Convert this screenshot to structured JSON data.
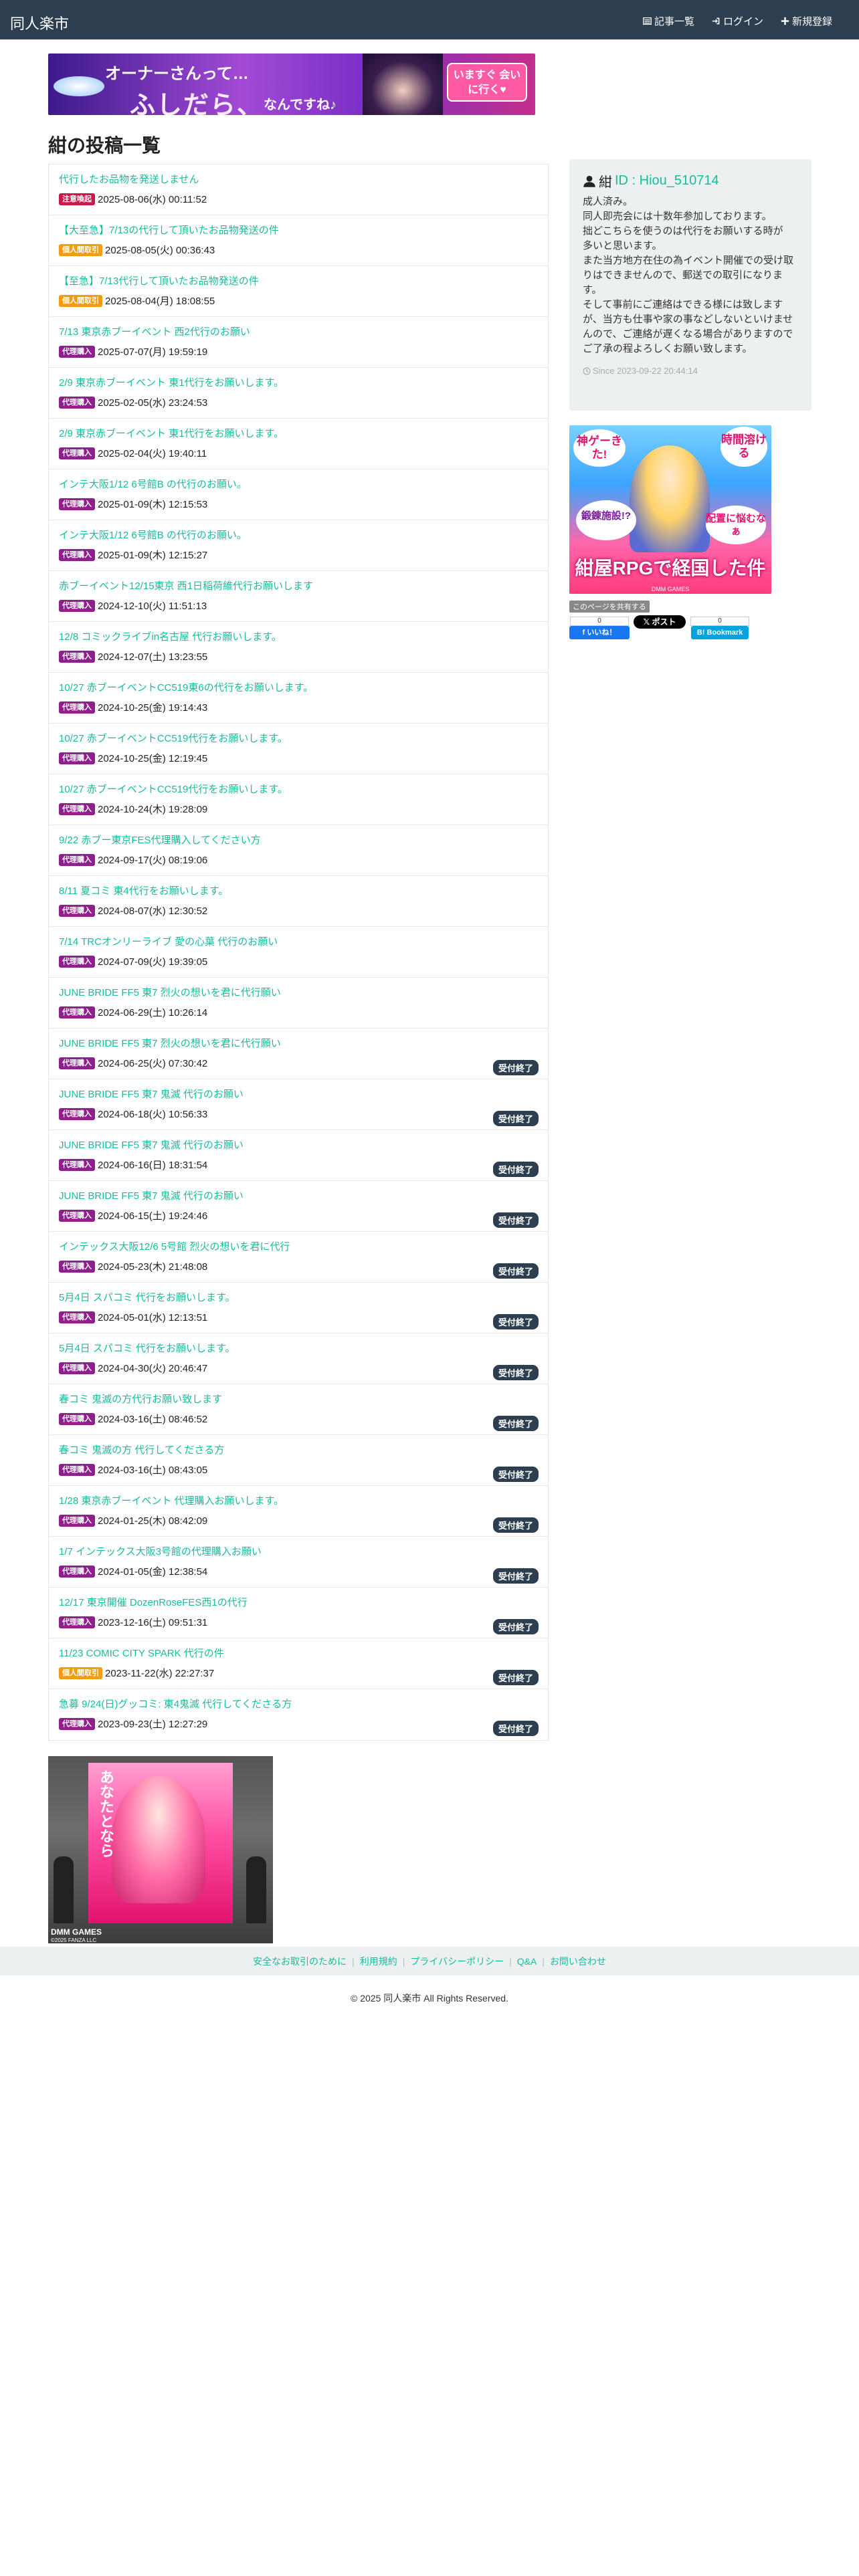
{
  "navbar": {
    "brand": "同人楽市",
    "items": [
      {
        "label": "記事一覧",
        "icon": "list-icon"
      },
      {
        "label": "ログイン",
        "icon": "sign-in-icon"
      },
      {
        "label": "新規登録",
        "icon": "plus-icon"
      }
    ]
  },
  "banner_top": {
    "line1": "オーナーさんって…",
    "line2": "ふしだら、",
    "line3": "なんですね♪",
    "cta": "いますぐ 会いに行く♥"
  },
  "page_title": "紺の投稿一覧",
  "badge_colors": {
    "注意喚起": "#c9184a",
    "個人間取引": "#f39c12",
    "代理購入": "#8e1f8c"
  },
  "posts": [
    {
      "title": "代行したお品物を発送しません",
      "category": "注意喚起",
      "date": "2025-08-06(水) 00:11:52",
      "status": ""
    },
    {
      "title": "【大至急】7/13の代行して頂いたお品物発送の件",
      "category": "個人間取引",
      "date": "2025-08-05(火) 00:36:43",
      "status": ""
    },
    {
      "title": "【至急】7/13代行して頂いたお品物発送の件",
      "category": "個人間取引",
      "date": "2025-08-04(月) 18:08:55",
      "status": ""
    },
    {
      "title": "7/13 東京赤ブーイベント 西2代行のお願い",
      "category": "代理購入",
      "date": "2025-07-07(月) 19:59:19",
      "status": ""
    },
    {
      "title": "2/9 東京赤ブーイベント 東1代行をお願いします。",
      "category": "代理購入",
      "date": "2025-02-05(水) 23:24:53",
      "status": ""
    },
    {
      "title": "2/9 東京赤ブーイベント 東1代行をお願いします。",
      "category": "代理購入",
      "date": "2025-02-04(火) 19:40:11",
      "status": ""
    },
    {
      "title": "インテ大阪1/12 6号館B の代行のお願い。",
      "category": "代理購入",
      "date": "2025-01-09(木) 12:15:53",
      "status": ""
    },
    {
      "title": "インテ大阪1/12 6号館B の代行のお願い。",
      "category": "代理購入",
      "date": "2025-01-09(木) 12:15:27",
      "status": ""
    },
    {
      "title": "赤ブーイベント12/15東京 西1日稲荷維代行お願いします",
      "category": "代理購入",
      "date": "2024-12-10(火) 11:51:13",
      "status": ""
    },
    {
      "title": "12/8 コミックライブin名古屋 代行お願いします。",
      "category": "代理購入",
      "date": "2024-12-07(土) 13:23:55",
      "status": ""
    },
    {
      "title": "10/27 赤ブーイベントCC519東6の代行をお願いします。",
      "category": "代理購入",
      "date": "2024-10-25(金) 19:14:43",
      "status": ""
    },
    {
      "title": "10/27 赤ブーイベントCC519代行をお願いします。",
      "category": "代理購入",
      "date": "2024-10-25(金) 12:19:45",
      "status": ""
    },
    {
      "title": "10/27 赤ブーイベントCC519代行をお願いします。",
      "category": "代理購入",
      "date": "2024-10-24(木) 19:28:09",
      "status": ""
    },
    {
      "title": "9/22 赤ブー東京FES代理購入してください方",
      "category": "代理購入",
      "date": "2024-09-17(火) 08:19:06",
      "status": ""
    },
    {
      "title": "8/11 夏コミ 東4代行をお願いします。",
      "category": "代理購入",
      "date": "2024-08-07(水) 12:30:52",
      "status": ""
    },
    {
      "title": "7/14 TRCオンリーライブ 愛の心葉 代行のお願い",
      "category": "代理購入",
      "date": "2024-07-09(火) 19:39:05",
      "status": ""
    },
    {
      "title": "JUNE BRIDE FF5 東7 烈火の想いを君に代行願い",
      "category": "代理購入",
      "date": "2024-06-29(土) 10:26:14",
      "status": ""
    },
    {
      "title": "JUNE BRIDE FF5 東7 烈火の想いを君に代行願い",
      "category": "代理購入",
      "date": "2024-06-25(火) 07:30:42",
      "status": "受付終了"
    },
    {
      "title": "JUNE BRIDE FF5 東7 鬼滅 代行のお願い",
      "category": "代理購入",
      "date": "2024-06-18(火) 10:56:33",
      "status": "受付終了"
    },
    {
      "title": "JUNE BRIDE FF5 東7 鬼滅 代行のお願い",
      "category": "代理購入",
      "date": "2024-06-16(日) 18:31:54",
      "status": "受付終了"
    },
    {
      "title": "JUNE BRIDE FF5 東7 鬼滅 代行のお願い",
      "category": "代理購入",
      "date": "2024-06-15(土) 19:24:46",
      "status": "受付終了"
    },
    {
      "title": "インテックス大阪12/6 5号館 烈火の想いを君に代行",
      "category": "代理購入",
      "date": "2024-05-23(木) 21:48:08",
      "status": "受付終了"
    },
    {
      "title": "5月4日 スパコミ 代行をお願いします。",
      "category": "代理購入",
      "date": "2024-05-01(水) 12:13:51",
      "status": "受付終了"
    },
    {
      "title": "5月4日 スパコミ 代行をお願いします。",
      "category": "代理購入",
      "date": "2024-04-30(火) 20:46:47",
      "status": "受付終了"
    },
    {
      "title": "春コミ 鬼滅の方代行お願い致します",
      "category": "代理購入",
      "date": "2024-03-16(土) 08:46:52",
      "status": "受付終了"
    },
    {
      "title": "春コミ 鬼滅の方 代行してくださる方",
      "category": "代理購入",
      "date": "2024-03-16(土) 08:43:05",
      "status": "受付終了"
    },
    {
      "title": "1/28 東京赤ブーイベント 代理購入お願いします。",
      "category": "代理購入",
      "date": "2024-01-25(木) 08:42:09",
      "status": "受付終了"
    },
    {
      "title": "1/7 インテックス大阪3号館の代理購入お願い",
      "category": "代理購入",
      "date": "2024-01-05(金) 12:38:54",
      "status": "受付終了"
    },
    {
      "title": "12/17 東京開催 DozenRoseFES西1の代行",
      "category": "代理購入",
      "date": "2023-12-16(土) 09:51:31",
      "status": "受付終了"
    },
    {
      "title": "11/23 COMIC CITY SPARK 代行の件",
      "category": "個人間取引",
      "date": "2023-11-22(水) 22:27:37",
      "status": "受付終了"
    },
    {
      "title": "急募 9/24(日)グッコミ: 東4鬼滅 代行してくださる方",
      "category": "代理購入",
      "date": "2023-09-23(土) 12:27:29",
      "status": "受付終了"
    }
  ],
  "profile": {
    "name": "紺",
    "id": "ID : Hiou_510714",
    "bio": "成人済み。\n同人即売会には十数年参加しております。\n拙どこちらを使うのは代行をお願いする時が\n多いと思います。\nまた当方地方在住の為イベント開催での受け取りはできませんので、郵送での取引になります。\nそして事前にご連絡はできる様には致しますが、当方も仕事や家の事などしないといけませんので、ご連絡が遅くなる場合がありますのでご了承の程よろしくお願い致します。",
    "since": "Since 2023-09-22 20:44:14"
  },
  "banner_side": {
    "bubble_left": "神ゲーきた!",
    "bubble_right": "時間溶ける",
    "tag_left": "鍛錬施設!?",
    "tag_right": "配置に悩むなぁ",
    "headline": "紺屋RPGで経国した件",
    "footer": "DMM GAMES"
  },
  "share": {
    "label": "このページを共有する",
    "fb_count": "0",
    "fb_label": "いいね！",
    "x_label": "ポスト",
    "hb_count": "0",
    "hb_label": "Bookmark"
  },
  "banner_bottom": {
    "vertical_text": "あなたとなら",
    "brand": "DMM GAMES",
    "copy": "©2025 FANZA LLC"
  },
  "footer": {
    "links": [
      "安全なお取引のために",
      "利用規約",
      "プライバシーポリシー",
      "Q&A",
      "お問い合わせ"
    ],
    "copyright": "© 2025 同人楽市 All Rights Reserved."
  }
}
